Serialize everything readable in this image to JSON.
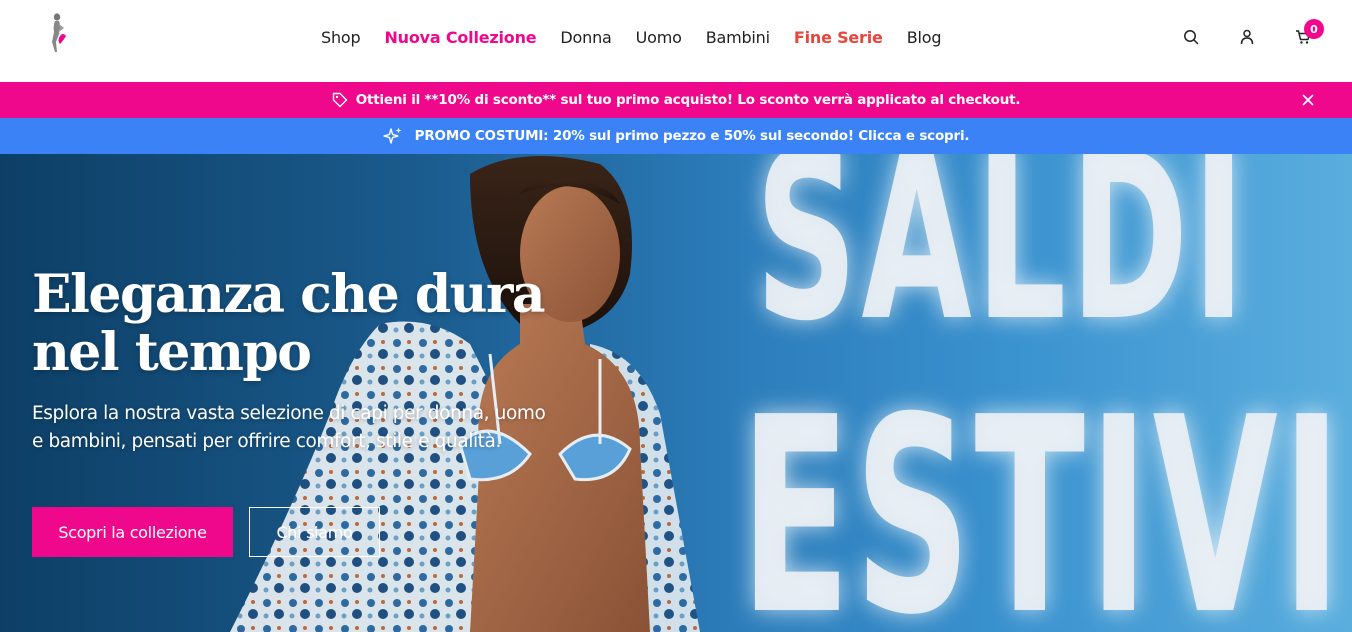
{
  "nav": {
    "items": [
      {
        "label": "Shop",
        "style": "normal"
      },
      {
        "label": "Nuova Collezione",
        "style": "pink"
      },
      {
        "label": "Donna",
        "style": "normal"
      },
      {
        "label": "Uomo",
        "style": "normal"
      },
      {
        "label": "Bambini",
        "style": "normal"
      },
      {
        "label": "Fine Serie",
        "style": "red"
      },
      {
        "label": "Blog",
        "style": "normal"
      }
    ]
  },
  "header_icons": {
    "search": "search-icon",
    "account": "user-icon",
    "cart": "cart-icon",
    "cart_count": "0"
  },
  "announcement": {
    "discount_text": "Ottieni il **10% di sconto** sul tuo primo acquisto! Lo sconto verrà applicato al checkout.",
    "promo_text": "PROMO COSTUMI: 20% sul primo pezzo e 50% sul secondo! Clicca e scopri."
  },
  "hero": {
    "background_word_1": "SALDI",
    "background_word_2": "ESTIVI",
    "title_line_1": "Eleganza che dura",
    "title_line_2": "nel tempo",
    "subtitle": "Esplora la nostra vasta selezione di capi per donna, uomo e bambini, pensati per offrire comfort, stile e qualità.",
    "primary_button": "Scopri la collezione",
    "secondary_button": "Chi siamo"
  },
  "colors": {
    "brand_pink": "#f0088c",
    "sale_red": "#e8453c",
    "promo_blue": "#3b82f6"
  }
}
